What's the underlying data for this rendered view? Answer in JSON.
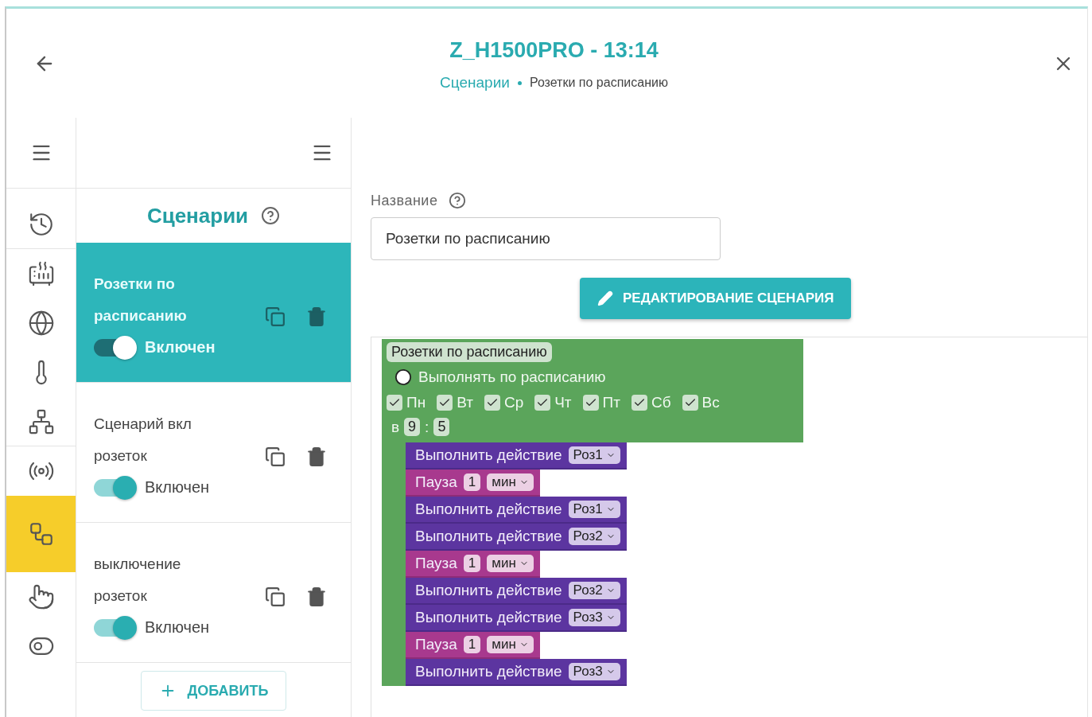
{
  "window": {
    "title": "Z_H1500PRO - 13:14",
    "breadcrumb": [
      {
        "label": "Сценарии",
        "kind": "link"
      },
      {
        "label": "Розетки по расписанию",
        "kind": "current"
      }
    ]
  },
  "rail": [
    {
      "selected": false
    },
    {
      "selected": false
    },
    {
      "selected": false
    },
    {
      "selected": false
    },
    {
      "selected": false
    },
    {
      "selected": false
    },
    {
      "selected": true
    },
    {
      "selected": false
    },
    {
      "selected": false
    }
  ],
  "scenarios": {
    "title": "Сценарии",
    "items": [
      {
        "name": "Розетки по расписанию",
        "selected": true,
        "on": true,
        "status": "Включен"
      },
      {
        "name": "Сценарий вкл розеток",
        "selected": false,
        "on": true,
        "status": "Включен"
      },
      {
        "name": "выключение розеток",
        "selected": false,
        "on": true,
        "status": "Включен"
      }
    ],
    "add_button": "ДОБАВИТЬ"
  },
  "editor": {
    "name_label": "Название",
    "name_value": "Розетки по расписанию",
    "edit_button": "РЕДАКТИРОВАНИЕ СЦЕНАРИЯ",
    "workspace": {
      "title": "Розетки по расписанию",
      "trigger": "Выполнять по расписанию",
      "days": [
        {
          "label": "Пн",
          "checked": true
        },
        {
          "label": "Вт",
          "checked": true
        },
        {
          "label": "Ср",
          "checked": true
        },
        {
          "label": "Чт",
          "checked": true
        },
        {
          "label": "Пт",
          "checked": true
        },
        {
          "label": "Сб",
          "checked": true
        },
        {
          "label": "Вс",
          "checked": true
        }
      ],
      "time": {
        "prefix": "в",
        "hour": "9",
        "separator": ":",
        "minute": "5"
      },
      "blocks": [
        {
          "kind": "action",
          "label": "Выполнить действие",
          "target": "Роз1"
        },
        {
          "kind": "pause",
          "label": "Пауза",
          "amount": "1",
          "unit": "мин"
        },
        {
          "kind": "action",
          "label": "Выполнить действие",
          "target": "Роз1"
        },
        {
          "kind": "action",
          "label": "Выполнить действие",
          "target": "Роз2"
        },
        {
          "kind": "pause",
          "label": "Пауза",
          "amount": "1",
          "unit": "мин"
        },
        {
          "kind": "action",
          "label": "Выполнить действие",
          "target": "Роз2"
        },
        {
          "kind": "action",
          "label": "Выполнить действие",
          "target": "Роз3"
        },
        {
          "kind": "pause",
          "label": "Пауза",
          "amount": "1",
          "unit": "мин"
        },
        {
          "kind": "action",
          "label": "Выполнить действие",
          "target": "Роз3"
        }
      ]
    }
  }
}
